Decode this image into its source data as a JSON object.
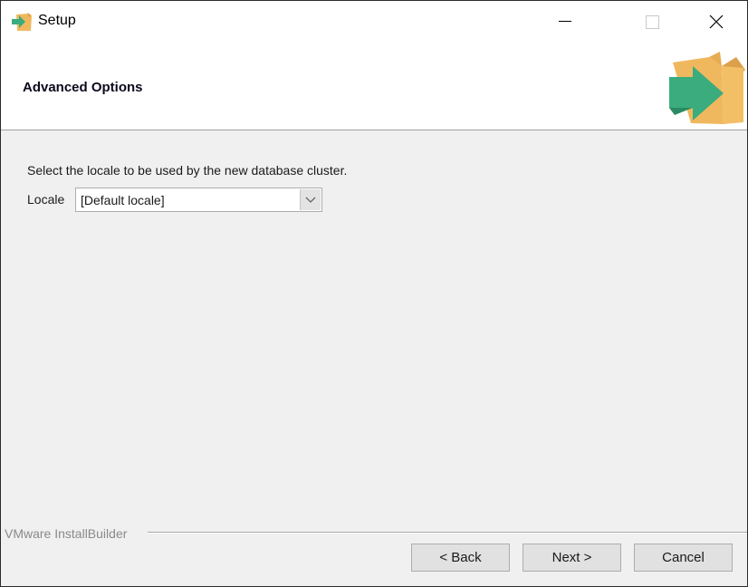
{
  "window": {
    "title": "Setup",
    "icon": "installer-box-arrow-icon",
    "controls": {
      "minimize": "minimize-icon",
      "maximize": "maximize-icon",
      "close": "close-icon"
    }
  },
  "header": {
    "title": "Advanced Options",
    "logo": "installer-box-arrow-icon"
  },
  "content": {
    "description": "Select the locale to be used by the new database cluster.",
    "locale": {
      "label": "Locale",
      "selected": "[Default locale]",
      "arrow_icon": "chevron-down-icon"
    }
  },
  "footer": {
    "brand": "VMware InstallBuilder",
    "buttons": {
      "back": "< Back",
      "next": "Next >",
      "cancel": "Cancel"
    }
  },
  "colors": {
    "box": "#f0b85e",
    "box_dark": "#dda04a",
    "arrow": "#3aac7e",
    "arrow_dark": "#2a8a63"
  }
}
